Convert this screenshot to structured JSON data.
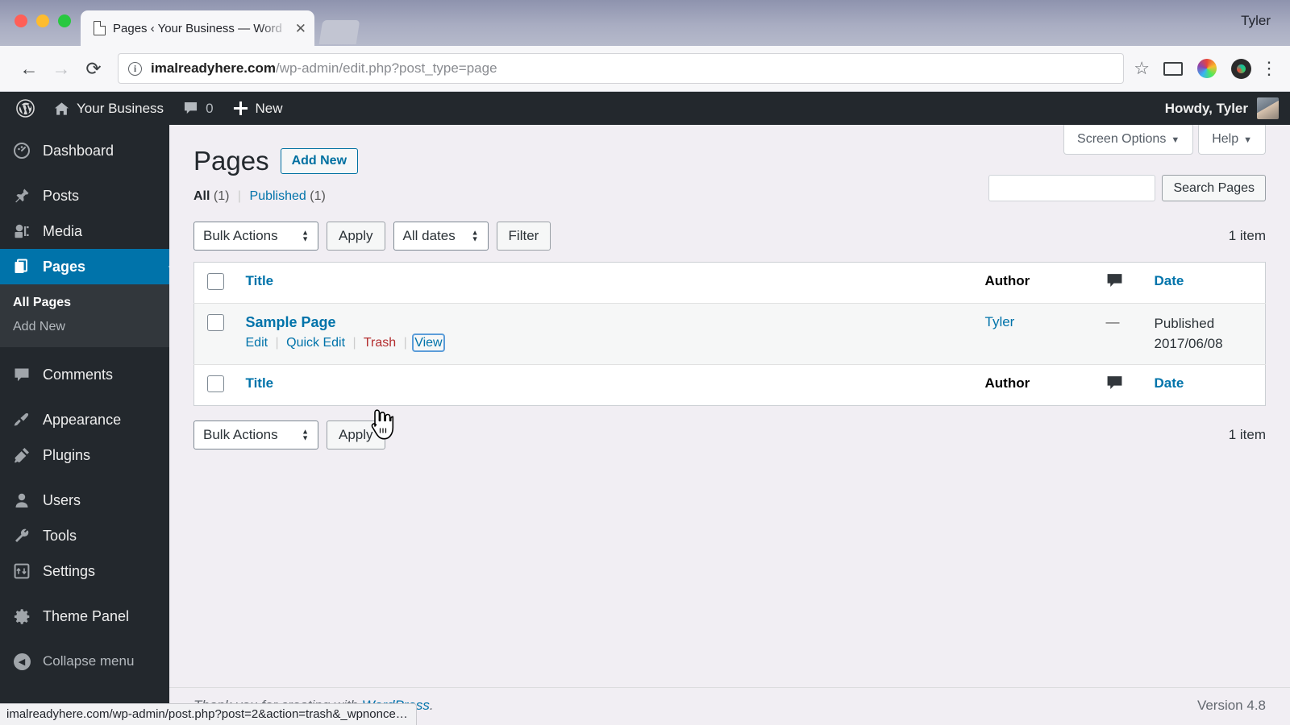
{
  "browser": {
    "tab_title": "Pages ‹ Your Business — Word",
    "tab_close": "✕",
    "window_user": "Tyler",
    "back_icon": "←",
    "forward_icon": "→",
    "reload_icon": "⟳",
    "url_domain": "imalreadyhere.com",
    "url_path": "/wp-admin/edit.php?post_type=page",
    "star_icon": "☆",
    "kebab_icon": "⋮",
    "status_bar": "imalreadyhere.com/wp-admin/post.php?post=2&action=trash&_wpnonce…"
  },
  "adminbar": {
    "logo_name": "wordpress-logo-icon",
    "site_name": "Your Business",
    "comments_count": "0",
    "new_label": "New",
    "howdy": "Howdy, Tyler"
  },
  "sidebar": {
    "items": [
      {
        "label": "Dashboard",
        "icon": "dashboard-icon",
        "current": false
      },
      {
        "label": "Posts",
        "icon": "pin-icon",
        "current": false
      },
      {
        "label": "Media",
        "icon": "media-icon",
        "current": false
      },
      {
        "label": "Pages",
        "icon": "pages-icon",
        "current": true
      },
      {
        "label": "Comments",
        "icon": "comment-icon",
        "current": false
      },
      {
        "label": "Appearance",
        "icon": "brush-icon",
        "current": false
      },
      {
        "label": "Plugins",
        "icon": "plug-icon",
        "current": false
      },
      {
        "label": "Users",
        "icon": "user-icon",
        "current": false
      },
      {
        "label": "Tools",
        "icon": "wrench-icon",
        "current": false
      },
      {
        "label": "Settings",
        "icon": "settings-icon",
        "current": false
      },
      {
        "label": "Theme Panel",
        "icon": "gear-icon",
        "current": false
      }
    ],
    "submenu": [
      {
        "label": "All Pages",
        "active": true
      },
      {
        "label": "Add New",
        "active": false
      }
    ],
    "collapse_label": "Collapse menu",
    "collapse_icon": "◀"
  },
  "screen_meta": {
    "screen_options": "Screen Options",
    "help": "Help",
    "caret": "▼"
  },
  "page": {
    "title": "Pages",
    "add_new": "Add New",
    "filters": [
      {
        "label": "All",
        "count": "(1)",
        "current": true
      },
      {
        "label": "Published",
        "count": "(1)",
        "current": false
      }
    ],
    "filter_separator": "|"
  },
  "search": {
    "value": "",
    "placeholder": "",
    "button": "Search Pages"
  },
  "tablenav_top": {
    "bulk_actions": "Bulk Actions",
    "apply": "Apply",
    "all_dates": "All dates",
    "filter": "Filter",
    "item_count": "1 item"
  },
  "tablenav_bottom": {
    "bulk_actions": "Bulk Actions",
    "apply": "Apply",
    "item_count": "1 item"
  },
  "table": {
    "columns": {
      "title": "Title",
      "author": "Author",
      "comments_icon": "comment-bubble-icon",
      "date": "Date"
    },
    "rows": [
      {
        "title": "Sample Page",
        "actions": {
          "edit": "Edit",
          "quick_edit": "Quick Edit",
          "trash": "Trash",
          "view": "View",
          "separator": "|"
        },
        "author": "Tyler",
        "comments": "—",
        "date_status": "Published",
        "date_value": "2017/06/08"
      }
    ]
  },
  "footer": {
    "thanks_prefix": "Thank you for creating with ",
    "thanks_link": "WordPress",
    "thanks_suffix": ".",
    "version": "Version 4.8"
  },
  "colors": {
    "wp_blue": "#0073aa",
    "admin_dark": "#23282d",
    "submenu_dark": "#32373c",
    "trash_red": "#b32d2e",
    "content_bg": "#f1eef3"
  }
}
